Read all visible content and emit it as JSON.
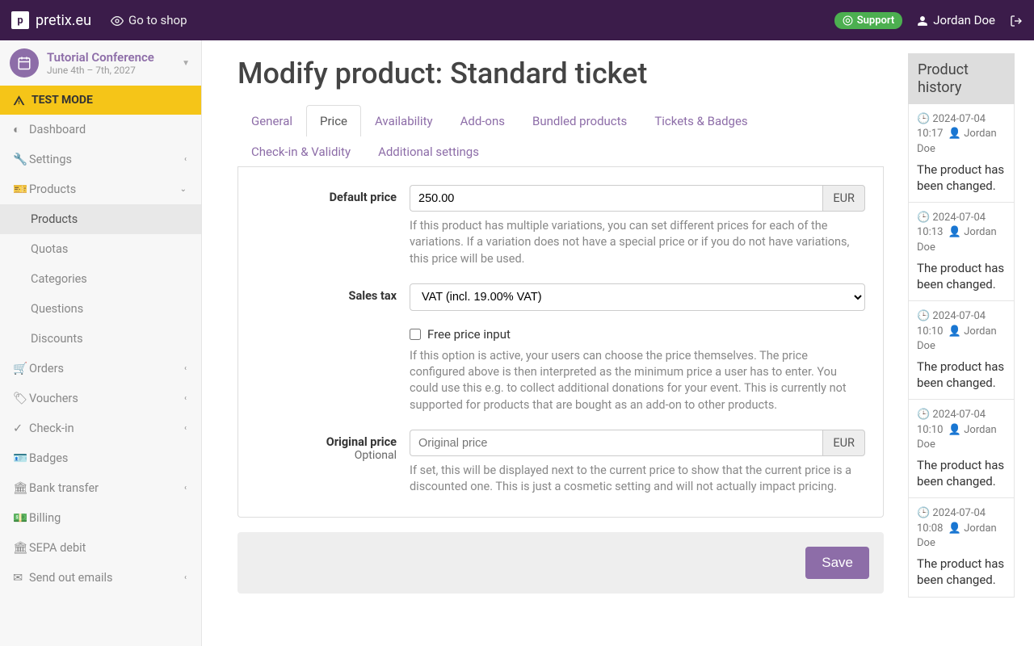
{
  "topbar": {
    "brand": "pretix.eu",
    "shop_link": "Go to shop",
    "support": "Support",
    "user_name": "Jordan Doe"
  },
  "sidebar": {
    "event_title": "Tutorial Conference",
    "event_dates": "June 4th – 7th, 2027",
    "test_mode": "TEST MODE",
    "items": [
      {
        "label": "Dashboard"
      },
      {
        "label": "Settings"
      },
      {
        "label": "Products"
      },
      {
        "label": "Orders"
      },
      {
        "label": "Vouchers"
      },
      {
        "label": "Check-in"
      },
      {
        "label": "Badges"
      },
      {
        "label": "Bank transfer"
      },
      {
        "label": "Billing"
      },
      {
        "label": "SEPA debit"
      },
      {
        "label": "Send out emails"
      }
    ],
    "products_sub": [
      {
        "label": "Products"
      },
      {
        "label": "Quotas"
      },
      {
        "label": "Categories"
      },
      {
        "label": "Questions"
      },
      {
        "label": "Discounts"
      }
    ]
  },
  "page": {
    "title": "Modify product: Standard ticket",
    "tabs": [
      "General",
      "Price",
      "Availability",
      "Add-ons",
      "Bundled products",
      "Tickets & Badges",
      "Check-in & Validity",
      "Additional settings"
    ],
    "active_tab": "Price"
  },
  "form": {
    "default_price": {
      "label": "Default price",
      "value": "250.00",
      "currency": "EUR",
      "help": "If this product has multiple variations, you can set different prices for each of the variations. If a variation does not have a special price or if you do not have variations, this price will be used."
    },
    "sales_tax": {
      "label": "Sales tax",
      "value": "VAT (incl. 19.00% VAT)"
    },
    "free_price": {
      "label": "Free price input",
      "help": "If this option is active, your users can choose the price themselves. The price configured above is then interpreted as the minimum price a user has to enter. You could use this e.g. to collect additional donations for your event. This is currently not supported for products that are bought as an add-on to other products."
    },
    "original_price": {
      "label": "Original price",
      "optional": "Optional",
      "placeholder": "Original price",
      "currency": "EUR",
      "help": "If set, this will be displayed next to the current price to show that the current price is a discounted one. This is just a cosmetic setting and will not actually impact pricing."
    },
    "save": "Save"
  },
  "history": {
    "title": "Product history",
    "entries": [
      {
        "ts": "2024-07-04 10:17",
        "user": "Jordan Doe",
        "msg": "The product has been changed."
      },
      {
        "ts": "2024-07-04 10:13",
        "user": "Jordan Doe",
        "msg": "The product has been changed."
      },
      {
        "ts": "2024-07-04 10:10",
        "user": "Jordan Doe",
        "msg": "The product has been changed."
      },
      {
        "ts": "2024-07-04 10:10",
        "user": "Jordan Doe",
        "msg": "The product has been changed."
      },
      {
        "ts": "2024-07-04 10:08",
        "user": "Jordan Doe",
        "msg": "The product has been changed."
      }
    ]
  }
}
